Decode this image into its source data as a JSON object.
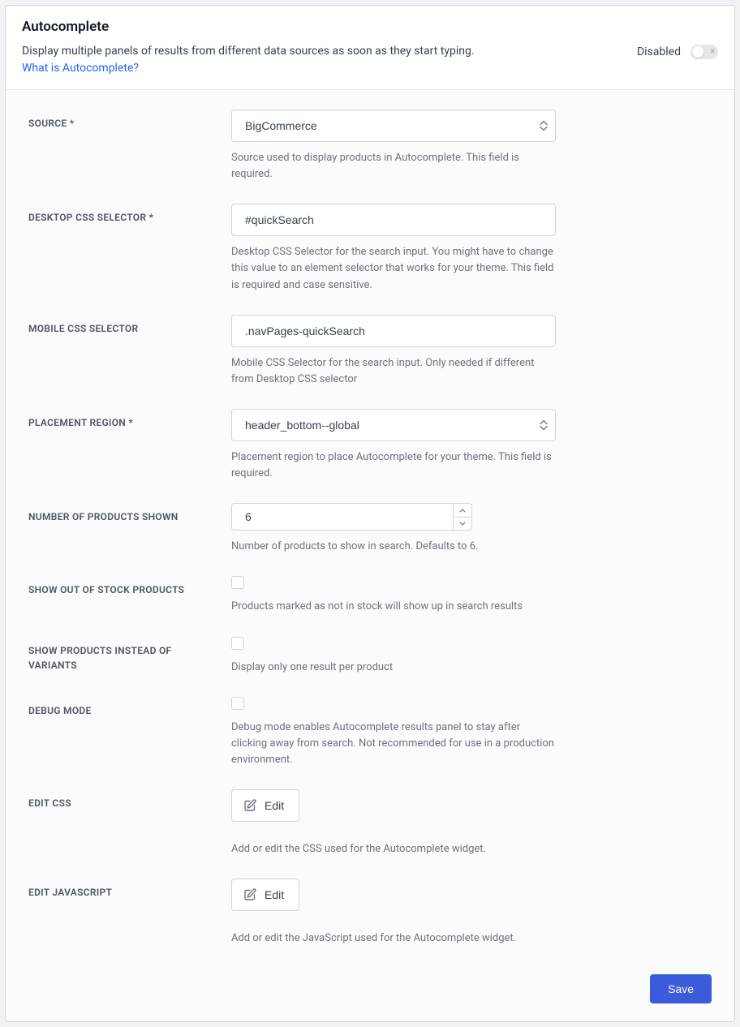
{
  "header": {
    "title": "Autocomplete",
    "description": "Display multiple panels of results from different data sources as soon as they start typing.",
    "link_text": "What is Autocomplete?",
    "toggle_label": "Disabled"
  },
  "fields": {
    "source": {
      "label": "SOURCE *",
      "value": "BigCommerce",
      "help": "Source used to display products in Autocomplete. This field is required."
    },
    "desktop_css": {
      "label": "DESKTOP CSS SELECTOR *",
      "value": "#quickSearch",
      "help": "Desktop CSS Selector for the search input. You might have to change this value to an element selector that works for your theme. This field is required and case sensitive."
    },
    "mobile_css": {
      "label": "MOBILE CSS SELECTOR",
      "value": ".navPages-quickSearch",
      "help": "Mobile CSS Selector for the search input. Only needed if different from Desktop CSS selector"
    },
    "placement": {
      "label": "PLACEMENT REGION *",
      "value": "header_bottom--global",
      "help": "Placement region to place Autocomplete for your theme. This field is required."
    },
    "num_products": {
      "label": "NUMBER OF PRODUCTS SHOWN",
      "value": "6",
      "help": "Number of products to show in search. Defaults to 6."
    },
    "out_of_stock": {
      "label": "SHOW OUT OF STOCK PRODUCTS",
      "help": "Products marked as not in stock will show up in search results"
    },
    "variants": {
      "label": "SHOW PRODUCTS INSTEAD OF VARIANTS",
      "help": "Display only one result per product"
    },
    "debug": {
      "label": "DEBUG MODE",
      "help": "Debug mode enables Autocomplete results panel to stay after clicking away from search. Not recommended for use in a production environment."
    },
    "edit_css": {
      "label": "EDIT CSS",
      "button": "Edit",
      "help": "Add or edit the CSS used for the Autocomplete widget."
    },
    "edit_js": {
      "label": "EDIT JAVASCRIPT",
      "button": "Edit",
      "help": "Add or edit the JavaScript used for the Autocomplete widget."
    }
  },
  "footer": {
    "save_label": "Save"
  }
}
